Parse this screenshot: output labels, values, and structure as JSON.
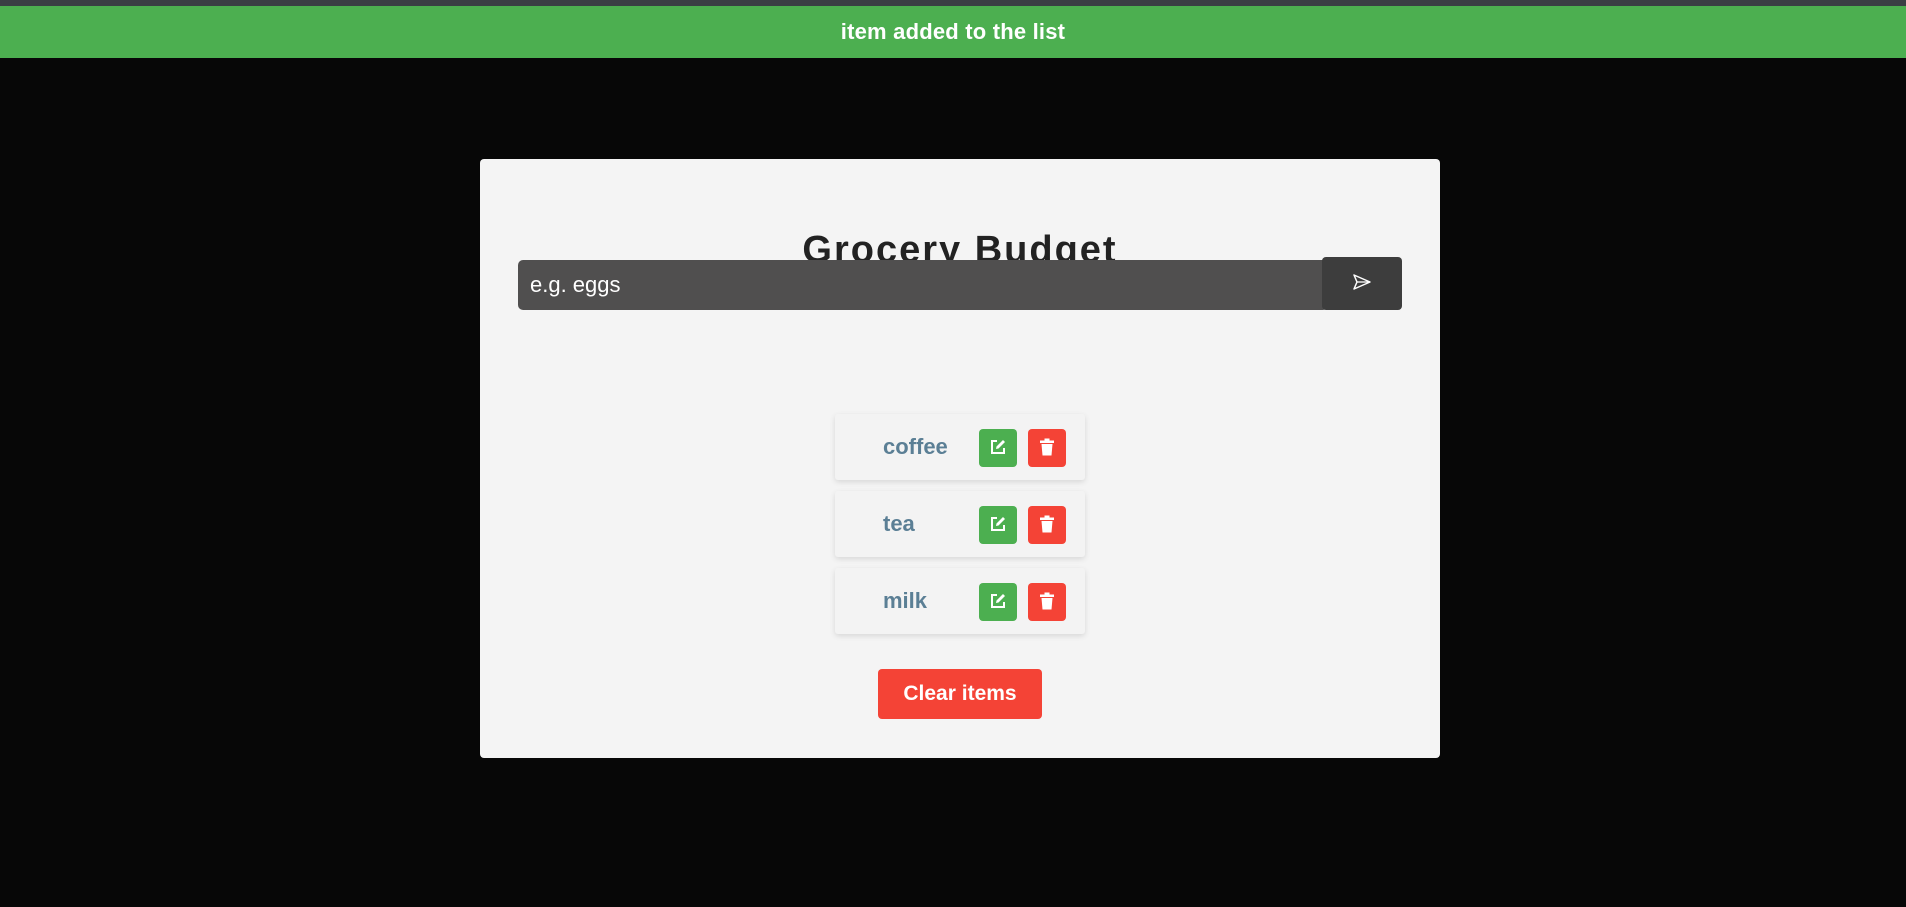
{
  "alert": {
    "text": "item added to the list",
    "color": "#4caf50"
  },
  "app": {
    "title": "Grocery Budget"
  },
  "form": {
    "placeholder": "e.g. eggs",
    "submit_icon": "send-icon"
  },
  "items": [
    {
      "name": "coffee",
      "edit_icon": "edit-icon",
      "delete_icon": "trash-icon"
    },
    {
      "name": "tea",
      "edit_icon": "edit-icon",
      "delete_icon": "trash-icon"
    },
    {
      "name": "milk",
      "edit_icon": "edit-icon",
      "delete_icon": "trash-icon"
    }
  ],
  "clear_button": {
    "label": "Clear items"
  },
  "colors": {
    "success": "#4caf50",
    "danger": "#f44336",
    "item_text": "#5b7f95",
    "card": "#f4f4f4",
    "background": "#070707"
  }
}
